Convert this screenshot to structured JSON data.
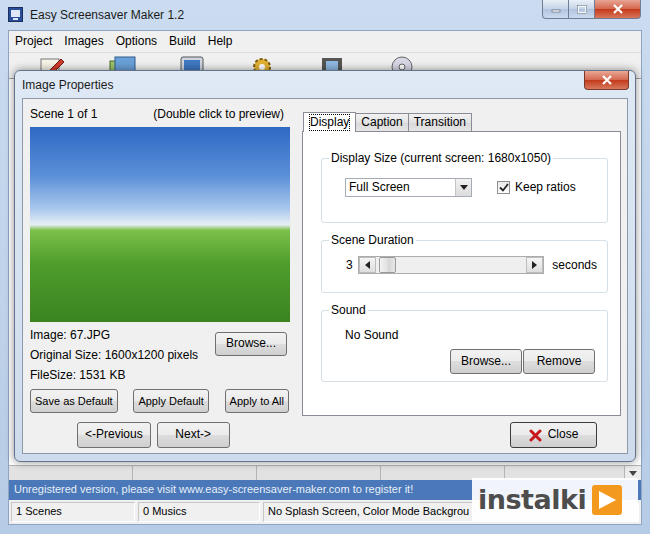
{
  "window": {
    "title": "Easy Screensaver Maker 1.2"
  },
  "menu": [
    "Project",
    "Images",
    "Options",
    "Build",
    "Help"
  ],
  "dialog": {
    "title": "Image Properties",
    "scene": "Scene 1 of 1",
    "hint": "(Double click to preview)",
    "image_name": "Image: 67.JPG",
    "original_size": "Original Size: 1600x1200 pixels",
    "file_size": "FileSize: 1531 KB",
    "browse": "Browse...",
    "actions": [
      "Save as Default",
      "Apply Default",
      "Apply to All"
    ],
    "nav": [
      "<-Previous",
      "Next->"
    ],
    "tabs": [
      {
        "label": "Display",
        "selected": true
      },
      {
        "label": "Caption",
        "selected": false
      },
      {
        "label": "Transition",
        "selected": false
      }
    ],
    "display_size": {
      "legend": "Display Size (current screen: 1680x1050)",
      "value": "Full Screen",
      "keep_ratios": {
        "label": "Keep ratios",
        "checked": true
      }
    },
    "duration": {
      "legend": "Scene Duration",
      "value": "3",
      "unit": "seconds",
      "level": 0.02
    },
    "sound": {
      "legend": "Sound",
      "value": "No Sound",
      "buttons": [
        "Browse...",
        "Remove"
      ]
    },
    "close": "Close"
  },
  "message": "Unregistered version, please visit www.easy-screensaver-maker.com to register it!",
  "status_bar": [
    "1 Scenes",
    "0 Musics",
    "No Splash Screen, Color Mode Backgrou"
  ],
  "watermark": "instalki"
}
